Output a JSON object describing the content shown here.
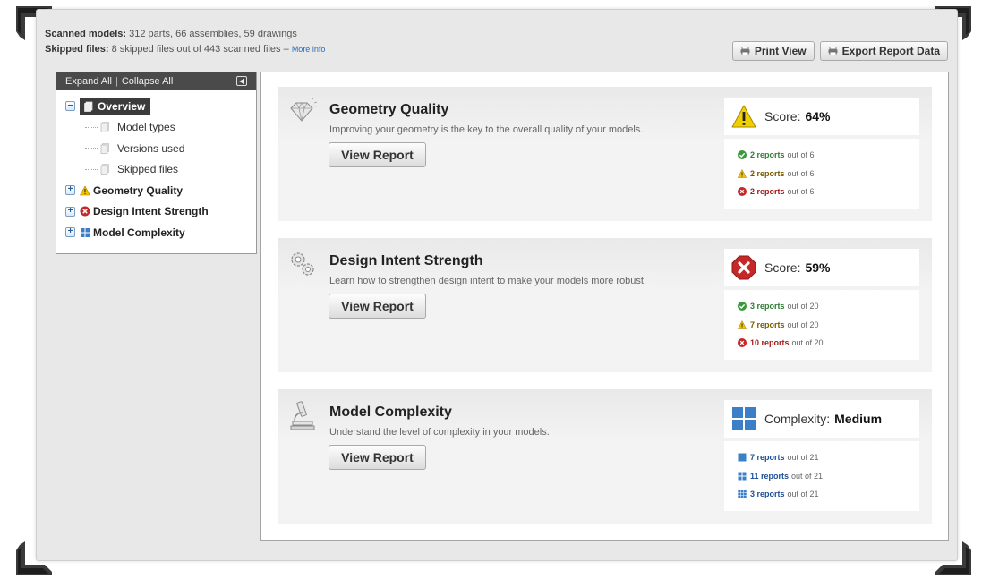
{
  "summary": {
    "scanned_label": "Scanned models:",
    "scanned_value": "312 parts, 66 assemblies, 59 drawings",
    "skipped_label": "Skipped files:",
    "skipped_value": "8 skipped files out of 443 scanned files",
    "skipped_dash": "–",
    "more_info": "More info"
  },
  "toolbar": {
    "print_view": "Print View",
    "export": "Export Report Data"
  },
  "tree": {
    "expand_all": "Expand All",
    "separator": "|",
    "collapse_all": "Collapse All",
    "overview": "Overview",
    "children": [
      "Model types",
      "Versions used",
      "Skipped files"
    ],
    "sections": [
      "Geometry Quality",
      "Design Intent Strength",
      "Model Complexity"
    ]
  },
  "cards": [
    {
      "title": "Geometry Quality",
      "description": "Improving your geometry is the key to the overall quality of your models.",
      "button": "View Report",
      "score_label": "Score:",
      "score_value": "64%",
      "reports": [
        {
          "count": "2 reports",
          "suffix": "out of 6",
          "status": "pass"
        },
        {
          "count": "2 reports",
          "suffix": "out of 6",
          "status": "warning"
        },
        {
          "count": "2 reports",
          "suffix": "out of 6",
          "status": "fail"
        }
      ]
    },
    {
      "title": "Design Intent Strength",
      "description": "Learn how to strengthen design intent to make your models more robust.",
      "button": "View Report",
      "score_label": "Score:",
      "score_value": "59%",
      "reports": [
        {
          "count": "3 reports",
          "suffix": "out of 20",
          "status": "pass"
        },
        {
          "count": "7 reports",
          "suffix": "out of 20",
          "status": "warning"
        },
        {
          "count": "10 reports",
          "suffix": "out of 20",
          "status": "fail"
        }
      ]
    },
    {
      "title": "Model Complexity",
      "description": "Understand the level of complexity in your models.",
      "button": "View Report",
      "score_label": "Complexity:",
      "score_value": "Medium",
      "reports": [
        {
          "count": "7 reports",
          "suffix": "out of 21",
          "status": "low"
        },
        {
          "count": "11 reports",
          "suffix": "out of 21",
          "status": "medium"
        },
        {
          "count": "3 reports",
          "suffix": "out of 21",
          "status": "high"
        }
      ]
    }
  ],
  "colors": {
    "pass": "#3a9a3a",
    "warning": "#f2c200",
    "fail": "#c62828",
    "complexity": "#3a7fc8",
    "tree_header": "#4a4a4a"
  }
}
